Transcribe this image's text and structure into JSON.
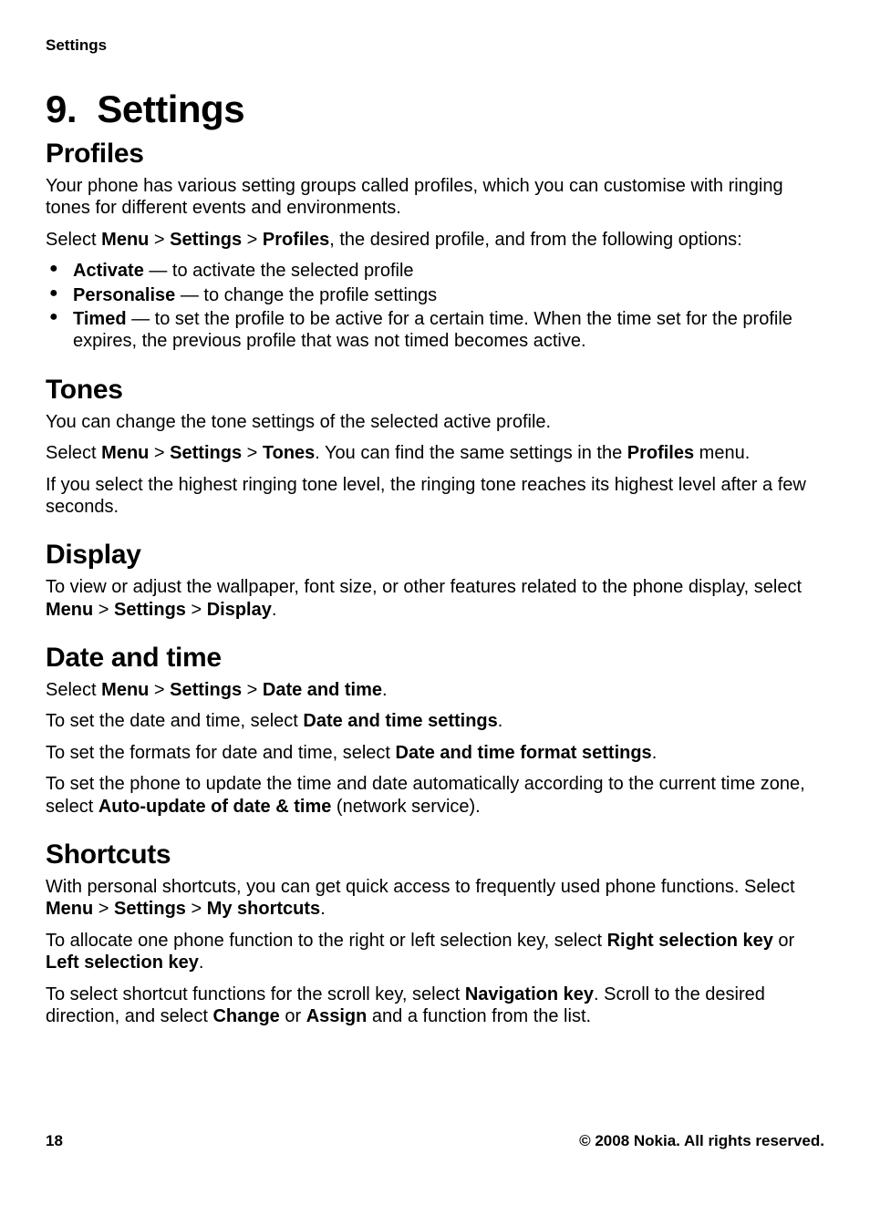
{
  "header": {
    "running": "Settings"
  },
  "chapter": {
    "num": "9.",
    "title": "Settings"
  },
  "profiles": {
    "heading": "Profiles",
    "p1": "Your phone has various setting groups called profiles, which you can customise with ringing tones for different events and environments.",
    "nav_pre": "Select ",
    "nav_menu": "Menu",
    "nav_sep": " > ",
    "nav_settings": "Settings",
    "nav_profiles": "Profiles",
    "nav_post": ", the desired profile, and from the following options:",
    "opts": {
      "activate_b": "Activate",
      "activate_t": " — to activate the selected profile",
      "personalise_b": "Personalise",
      "personalise_t": " — to change the profile settings",
      "timed_b": "Timed",
      "timed_t": " — to set the profile to be active for a certain time. When the time set for the profile expires, the previous profile that was not timed becomes active."
    }
  },
  "tones": {
    "heading": "Tones",
    "p1": "You can change the tone settings of the selected active profile.",
    "nav_pre": "Select ",
    "nav_menu": "Menu",
    "nav_sep": " > ",
    "nav_settings": "Settings",
    "nav_tones": "Tones",
    "nav_post1": ". You can find the same settings in the ",
    "nav_profiles_b": "Profiles",
    "nav_post2": " menu.",
    "p2": "If you select the highest ringing tone level, the ringing tone reaches its highest level after a few seconds."
  },
  "display": {
    "heading": "Display",
    "p1_pre": "To view or adjust the wallpaper, font size, or other features related to the phone display, select ",
    "nav_menu": "Menu",
    "nav_sep": " > ",
    "nav_settings": "Settings",
    "nav_display": "Display",
    "period": "."
  },
  "datetime": {
    "heading": "Date and time",
    "nav_pre": "Select ",
    "nav_menu": "Menu",
    "nav_sep": " > ",
    "nav_settings": "Settings",
    "nav_dt": "Date and time",
    "period": ".",
    "p2_pre": "To set the date and time, select ",
    "p2_b": "Date and time settings",
    "p3_pre": "To set the formats for date and time, select ",
    "p3_b": "Date and time format settings",
    "p4_pre": "To set the phone to update the time and date automatically according to the current time zone, select ",
    "p4_b": "Auto-update of date & time",
    "p4_post": " (network service)."
  },
  "shortcuts": {
    "heading": "Shortcuts",
    "p1_pre": "With personal shortcuts, you can get quick access to frequently used phone functions. Select ",
    "nav_menu": "Menu",
    "nav_sep": " > ",
    "nav_settings": "Settings",
    "nav_sc": "My shortcuts",
    "period": ".",
    "p2_pre": "To allocate one phone function to the right or left selection key, select ",
    "p2_b1": "Right selection key",
    "p2_mid": " or ",
    "p2_b2": "Left selection key",
    "p3_pre": "To select shortcut functions for the scroll key, select ",
    "p3_b1": "Navigation key",
    "p3_mid1": ". Scroll to the desired direction, and select ",
    "p3_b2": "Change",
    "p3_mid2": " or ",
    "p3_b3": "Assign",
    "p3_post": " and a function from the list."
  },
  "footer": {
    "page": "18",
    "copyright": "© 2008 Nokia. All rights reserved."
  }
}
